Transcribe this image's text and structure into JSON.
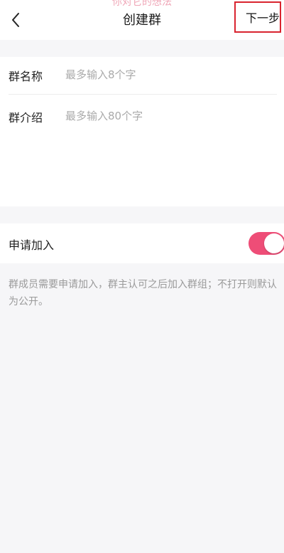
{
  "header": {
    "overlay_text": "你对它的想法",
    "title": "创建群",
    "next_label": "下一步"
  },
  "form": {
    "group_name": {
      "label": "群名称",
      "placeholder": "最多输入8个字",
      "value": ""
    },
    "group_intro": {
      "label": "群介绍",
      "placeholder": "最多输入80个字",
      "value": ""
    }
  },
  "join_setting": {
    "label": "申请加入",
    "enabled": true,
    "description": "群成员需要申请加入，群主认可之后加入群组；不打开则默认为公开。"
  },
  "colors": {
    "accent": "#ee4d77",
    "highlight_border": "#d9242f",
    "background": "#f6f6f8"
  },
  "icons": {
    "back": "chevron-left-icon"
  }
}
